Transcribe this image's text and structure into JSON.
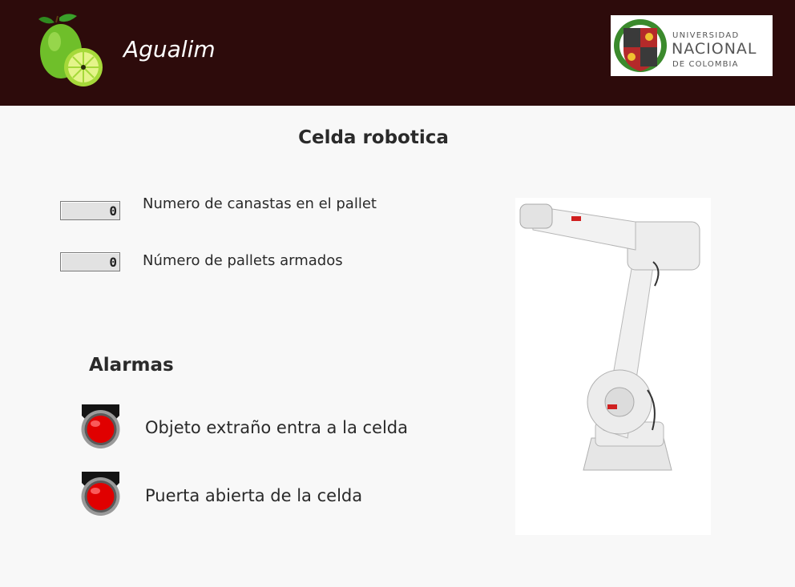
{
  "header": {
    "app_title": "Agualim",
    "logo_icon": "lime-logo-icon",
    "institution": {
      "line1": "UNIVERSIDAD",
      "line2": "NACIONAL",
      "line3": "DE COLOMBIA"
    },
    "background_color": "#2d0b0b"
  },
  "main": {
    "title": "Celda robotica",
    "counters": [
      {
        "value": "0",
        "label": "Numero de canastas en el pallet"
      },
      {
        "value": "0",
        "label": "Número de pallets armados"
      }
    ],
    "alarms": {
      "title": "Alarmas",
      "items": [
        {
          "label": "Objeto extraño entra a la celda",
          "state_color": "#e00000"
        },
        {
          "label": "Puerta abierta de la celda",
          "state_color": "#e00000"
        }
      ]
    },
    "image_icon": "industrial-robot-icon"
  }
}
